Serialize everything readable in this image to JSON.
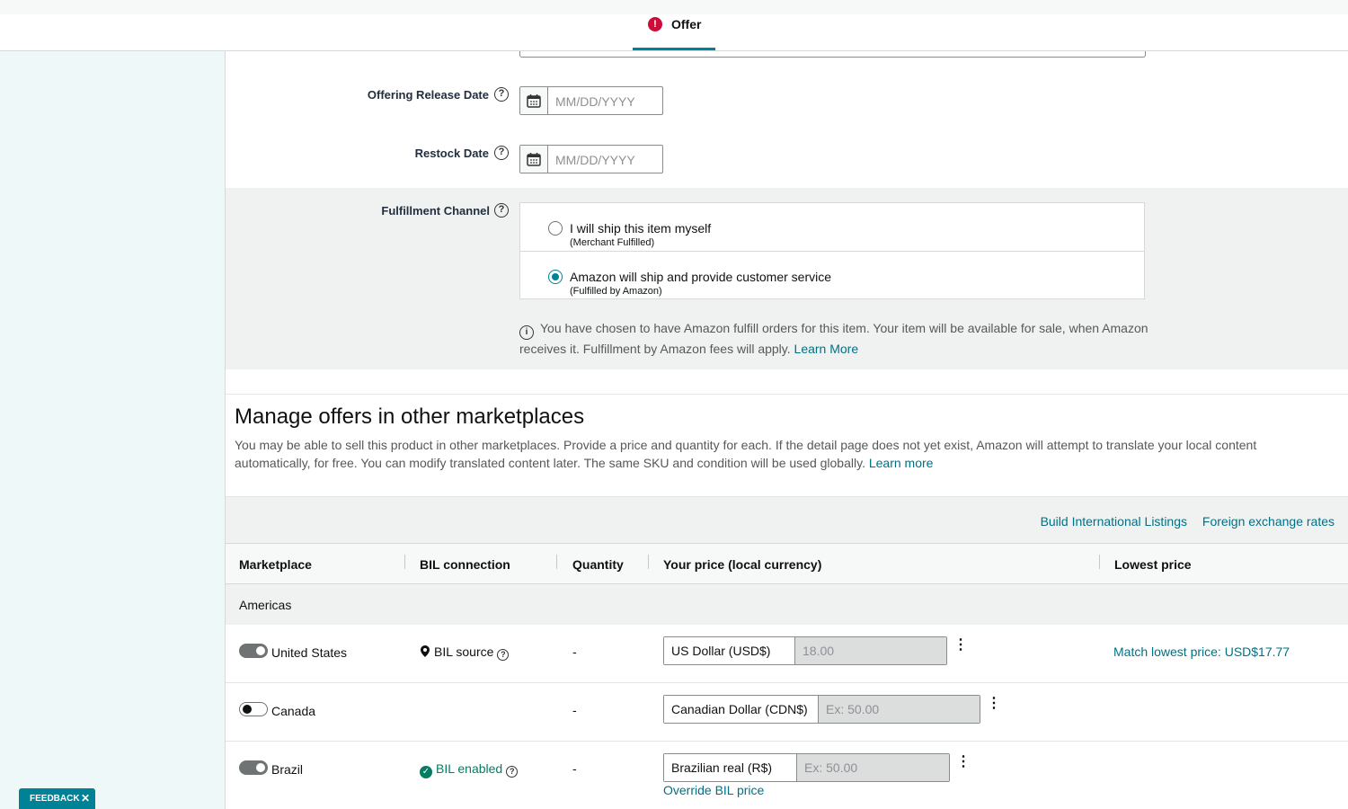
{
  "header": {
    "tab_label": "Offer",
    "tab_error_glyph": "!"
  },
  "form": {
    "release_date": {
      "label": "Offering Release Date",
      "placeholder": "MM/DD/YYYY"
    },
    "restock_date": {
      "label": "Restock Date",
      "placeholder": "MM/DD/YYYY"
    },
    "fulfillment": {
      "label": "Fulfillment Channel",
      "options": [
        {
          "label": "I will ship this item myself",
          "sub": "(Merchant Fulfilled)",
          "selected": false
        },
        {
          "label": "Amazon will ship and provide customer service",
          "sub": "(Fulfilled by Amazon)",
          "selected": true
        }
      ],
      "info_text": "You have chosen to have Amazon fulfill orders for this item. Your item will be available for sale, when Amazon receives it. Fulfillment by Amazon fees will apply.",
      "info_link": "Learn More"
    }
  },
  "marketplaces": {
    "title": "Manage offers in other marketplaces",
    "description": "You may be able to sell this product in other marketplaces. Provide a price and quantity for each. If the detail page does not yet exist, Amazon will attempt to translate your local content automatically, for free. You can modify translated content later. The same SKU and condition will be used globally.",
    "description_link": "Learn more",
    "links": [
      "Build International Listings",
      "Foreign exchange rates"
    ],
    "columns": [
      "Marketplace",
      "BIL connection",
      "Quantity",
      "Your price (local currency)",
      "Lowest price"
    ],
    "group": "Americas",
    "rows": [
      {
        "name": "United States",
        "toggle": "on",
        "bil": "BIL source",
        "quantity": "-",
        "currency": "US Dollar (USD$)",
        "price": "18.00",
        "lowest": "Match lowest price: USD$17.77"
      },
      {
        "name": "Canada",
        "toggle": "off",
        "bil": "",
        "quantity": "-",
        "currency": "Canadian Dollar (CDN$)",
        "price_placeholder": "Ex: 50.00",
        "lowest": ""
      },
      {
        "name": "Brazil",
        "toggle": "on",
        "bil": "BIL enabled",
        "quantity": "-",
        "currency": "Brazilian real (R$)",
        "price_placeholder": "Ex: 50.00",
        "override_link": "Override BIL price",
        "lowest": ""
      }
    ]
  },
  "feedback": {
    "label": "FEEDBACK",
    "close": "✕"
  },
  "colors": {
    "accent": "#008296",
    "link": "#007185",
    "error": "#cc0c39",
    "success": "#067d62"
  }
}
